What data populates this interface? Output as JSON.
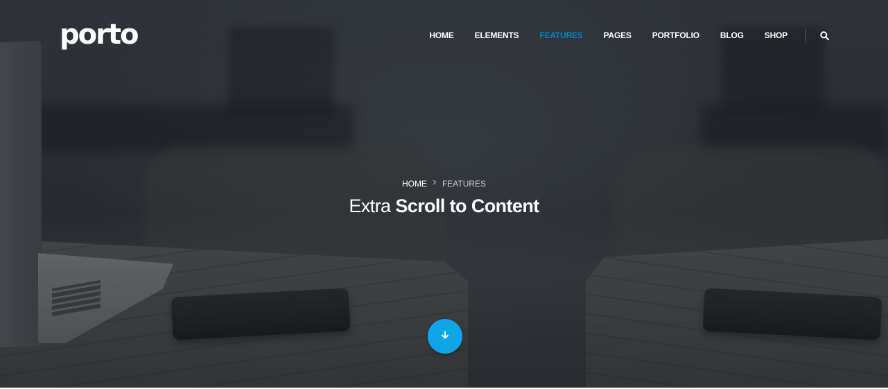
{
  "brand": {
    "logo_text": "porto"
  },
  "nav": {
    "items": [
      {
        "label": "HOME",
        "active": false
      },
      {
        "label": "ELEMENTS",
        "active": false
      },
      {
        "label": "FEATURES",
        "active": true
      },
      {
        "label": "PAGES",
        "active": false
      },
      {
        "label": "PORTFOLIO",
        "active": false
      },
      {
        "label": "BLOG",
        "active": false
      },
      {
        "label": "SHOP",
        "active": false
      }
    ],
    "search_icon": "search-icon"
  },
  "breadcrumb": {
    "home": "HOME",
    "current": "FEATURES",
    "separator_icon": "chevron-right-icon"
  },
  "page_title": {
    "light": "Extra",
    "bold": "Scroll to Content"
  },
  "scroll_button": {
    "icon": "arrow-down-icon"
  },
  "colors": {
    "accent": "#0088cc",
    "scroll_button": "#0ea5e9",
    "text": "#ffffff"
  }
}
